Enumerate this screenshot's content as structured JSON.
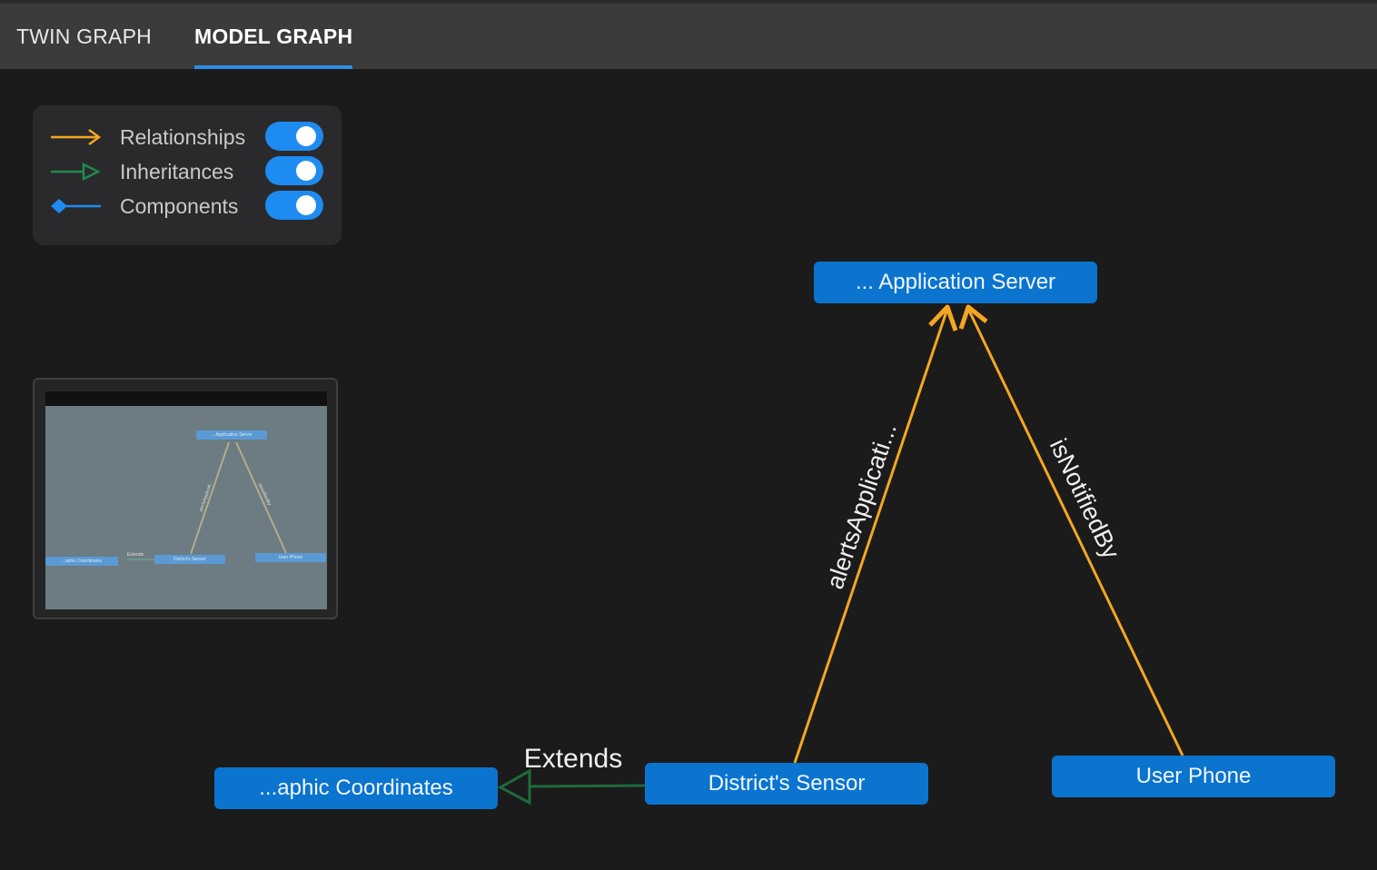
{
  "tabs": [
    {
      "label": "TWIN GRAPH",
      "active": false
    },
    {
      "label": "MODEL GRAPH",
      "active": true
    }
  ],
  "legend": {
    "items": [
      {
        "label": "Relationships",
        "color": "#f5a623",
        "enabled": true,
        "icon": "arrow-icon"
      },
      {
        "label": "Inheritances",
        "color": "#1f8a4c",
        "enabled": true,
        "icon": "hollow-triangle-arrow-icon"
      },
      {
        "label": "Components",
        "color": "#1e8bf0",
        "enabled": true,
        "icon": "diamond-line-icon"
      }
    ]
  },
  "graph": {
    "nodes": {
      "app_server": "... Application Server",
      "coordinates": "...aphic Coordinates",
      "district_sensor": "District's Sensor",
      "user_phone": "User Phone"
    },
    "edges": {
      "alerts": "alertsApplicati...",
      "notified": "isNotifiedBy",
      "extends": "Extends"
    }
  },
  "minimap": {
    "nodes": {
      "app_server": "... Application Server",
      "coordinates": "...aphic Coordinates",
      "district_sensor": "District's Sensor",
      "user_phone": "User Phone"
    },
    "edges": {
      "alerts": "alertsApplicati...",
      "notified": "isNotifiedBy",
      "extends": "Extends"
    }
  },
  "colors": {
    "relationship": "#f5a623",
    "inheritance": "#1f8a4c",
    "node": "#0a74cf",
    "accent": "#2f8de4"
  }
}
